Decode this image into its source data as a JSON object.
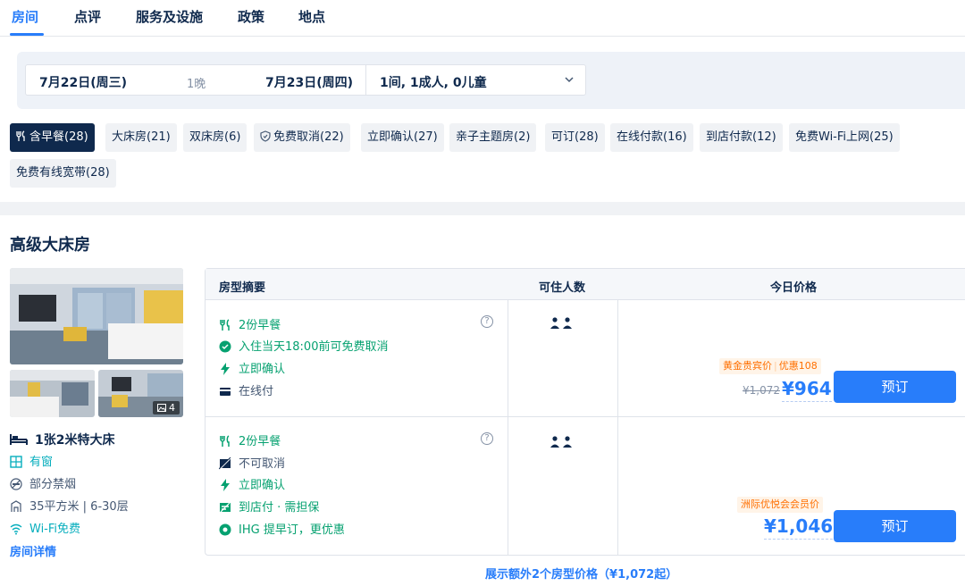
{
  "tabs": [
    "房间",
    "点评",
    "服务及设施",
    "政策",
    "地点"
  ],
  "search": {
    "checkin": "7月22日(周三)",
    "nights": "1晚",
    "checkout": "7月23日(周四)",
    "guests": "1间, 1成人, 0儿童"
  },
  "filters": [
    {
      "label": "含早餐(28)",
      "icon": "fork-knife-icon",
      "active": true
    },
    {
      "label": "大床房(21)"
    },
    {
      "label": "双床房(6)"
    },
    {
      "label": "免费取消(22)",
      "icon": "shield-icon"
    },
    {
      "label": "立即确认(27)"
    },
    {
      "label": "亲子主题房(2)"
    },
    {
      "label": "可订(28)"
    },
    {
      "label": "在线付款(16)"
    },
    {
      "label": "到店付款(12)"
    },
    {
      "label": "免费Wi-Fi上网(25)"
    },
    {
      "label": "免费有线宽带(28)"
    }
  ],
  "room": {
    "title": "高级大床房",
    "photo_count": "4",
    "bed": "1张2米特大床",
    "amenities": [
      {
        "icon": "window-icon",
        "label": "有窗",
        "color": "#06aebd"
      },
      {
        "icon": "no-smoking-icon",
        "label": "部分禁烟"
      },
      {
        "icon": "area-icon",
        "label": "35平方米 | 6-30层"
      },
      {
        "icon": "wifi-icon",
        "label": "Wi-Fi免费",
        "color": "#06aebd"
      }
    ],
    "details_link": "房间详情"
  },
  "table": {
    "headers": [
      "房型摘要",
      "可住人数",
      "今日价格"
    ],
    "rows": [
      {
        "features": [
          {
            "icon": "fork-knife-icon",
            "text": "2份早餐",
            "green": true
          },
          {
            "icon": "check-circle-icon",
            "text": "入住当天18:00前可免费取消",
            "green": true
          },
          {
            "icon": "bolt-icon",
            "text": "立即确认",
            "green": true
          },
          {
            "icon": "card-icon",
            "text": "在线付",
            "green": false
          }
        ],
        "badge_main": "黄金贵宾价",
        "badge_extra": "优惠108",
        "old_price": "¥1,072",
        "price": "¥964",
        "book_label": "预订"
      },
      {
        "features": [
          {
            "icon": "fork-knife-icon",
            "text": "2份早餐",
            "green": true
          },
          {
            "icon": "no-cancel-icon",
            "text": "不可取消",
            "green": false
          },
          {
            "icon": "bolt-icon",
            "text": "立即确认",
            "green": true
          },
          {
            "icon": "pay-at-hotel-icon",
            "text": "到店付 · 需担保",
            "green": true
          },
          {
            "icon": "ihg-icon",
            "text": "IHG 提早订，更优惠",
            "green": true
          }
        ],
        "badge_main": "洲际优悦会会员价",
        "price": "¥1,046",
        "book_label": "预订"
      }
    ],
    "more_link": "展示额外2个房型价格（¥1,072起）"
  },
  "colors": {
    "accent": "#287dfa",
    "green": "#06a170",
    "orange": "#ff6f00",
    "navy": "#0f294d"
  }
}
